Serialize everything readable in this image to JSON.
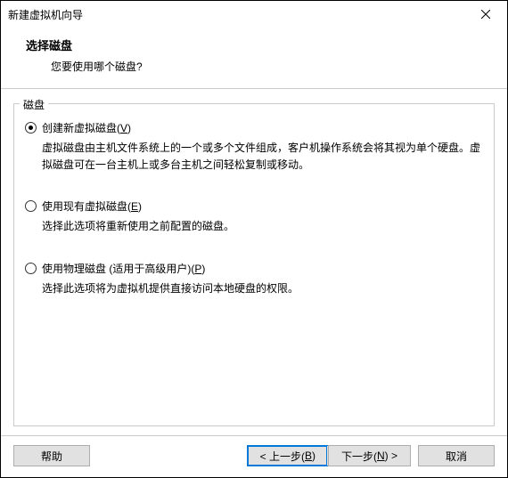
{
  "titlebar": {
    "title": "新建虚拟机向导"
  },
  "header": {
    "title": "选择磁盘",
    "subtitle": "您要使用哪个磁盘?"
  },
  "fieldset": {
    "legend": "磁盘"
  },
  "options": [
    {
      "label_pre": "创建新虚拟磁盘(",
      "label_key": "V",
      "label_post": ")",
      "description": "虚拟磁盘由主机文件系统上的一个或多个文件组成，客户机操作系统会将其视为单个硬盘。虚拟磁盘可在一台主机上或多台主机之间轻松复制或移动。",
      "checked": true
    },
    {
      "label_pre": "使用现有虚拟磁盘(",
      "label_key": "E",
      "label_post": ")",
      "description": "选择此选项将重新使用之前配置的磁盘。",
      "checked": false
    },
    {
      "label_pre": "使用物理磁盘 (适用于高级用户)(",
      "label_key": "P",
      "label_post": ")",
      "description": "选择此选项将为虚拟机提供直接访问本地硬盘的权限。",
      "checked": false
    }
  ],
  "buttons": {
    "help": "帮助",
    "back_pre": "< 上一步(",
    "back_key": "B",
    "back_post": ")",
    "next_pre": "下一步(",
    "next_key": "N",
    "next_post": ") >",
    "cancel": "取消"
  }
}
